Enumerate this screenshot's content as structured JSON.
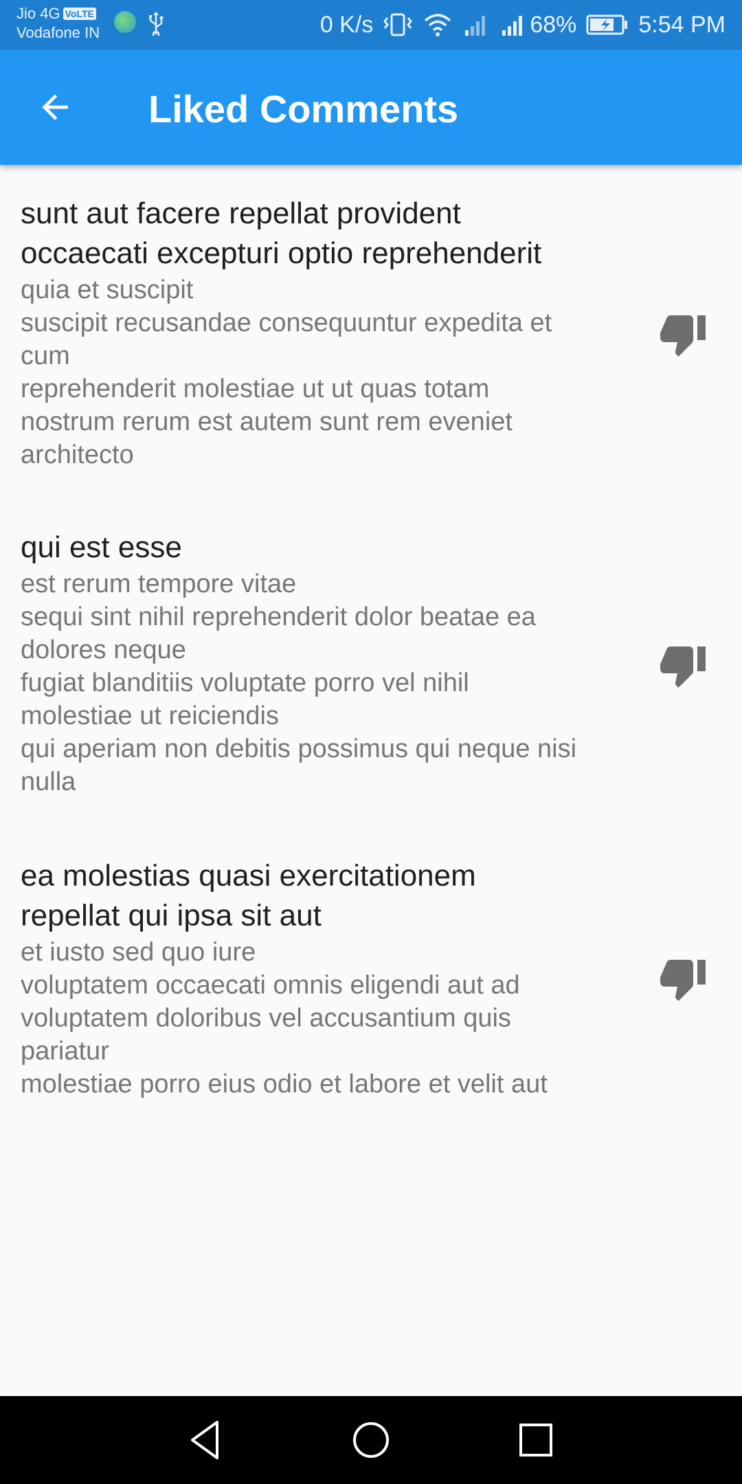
{
  "status_bar": {
    "carrier_1": "Jio 4G",
    "volte_badge": "VoLTE",
    "carrier_2": "Vodafone IN",
    "network_speed": "0 K/s",
    "battery_percent": "68%",
    "time": "5:54 PM"
  },
  "app_bar": {
    "title": "Liked Comments",
    "back_icon": "arrow-back-icon",
    "background": "#2196f3"
  },
  "comments": [
    {
      "title": "sunt aut facere repellat provident\noccaecati excepturi optio reprehenderit",
      "body": "quia et suscipit\nsuscipit recusandae consequuntur expedita et\ncum\nreprehenderit molestiae ut ut quas totam\nnostrum rerum est autem sunt rem eveniet\narchitecto",
      "action_icon": "thumb-down-icon"
    },
    {
      "title": "qui est esse",
      "body": "est rerum tempore vitae\nsequi sint nihil reprehenderit dolor beatae ea\ndolores neque\nfugiat blanditiis voluptate porro vel nihil\nmolestiae ut reiciendis\nqui aperiam non debitis possimus qui neque nisi\nnulla",
      "action_icon": "thumb-down-icon"
    },
    {
      "title": "ea molestias quasi exercitationem\nrepellat qui ipsa sit aut",
      "body": "et iusto sed quo iure\nvoluptatem occaecati omnis eligendi aut ad\nvoluptatem doloribus vel accusantium quis\npariatur\nmolestiae porro eius odio et labore et velit aut",
      "action_icon": "thumb-down-icon"
    }
  ],
  "nav_bar": {
    "back": "nav-back-icon",
    "home": "nav-home-icon",
    "recents": "nav-recents-icon"
  }
}
